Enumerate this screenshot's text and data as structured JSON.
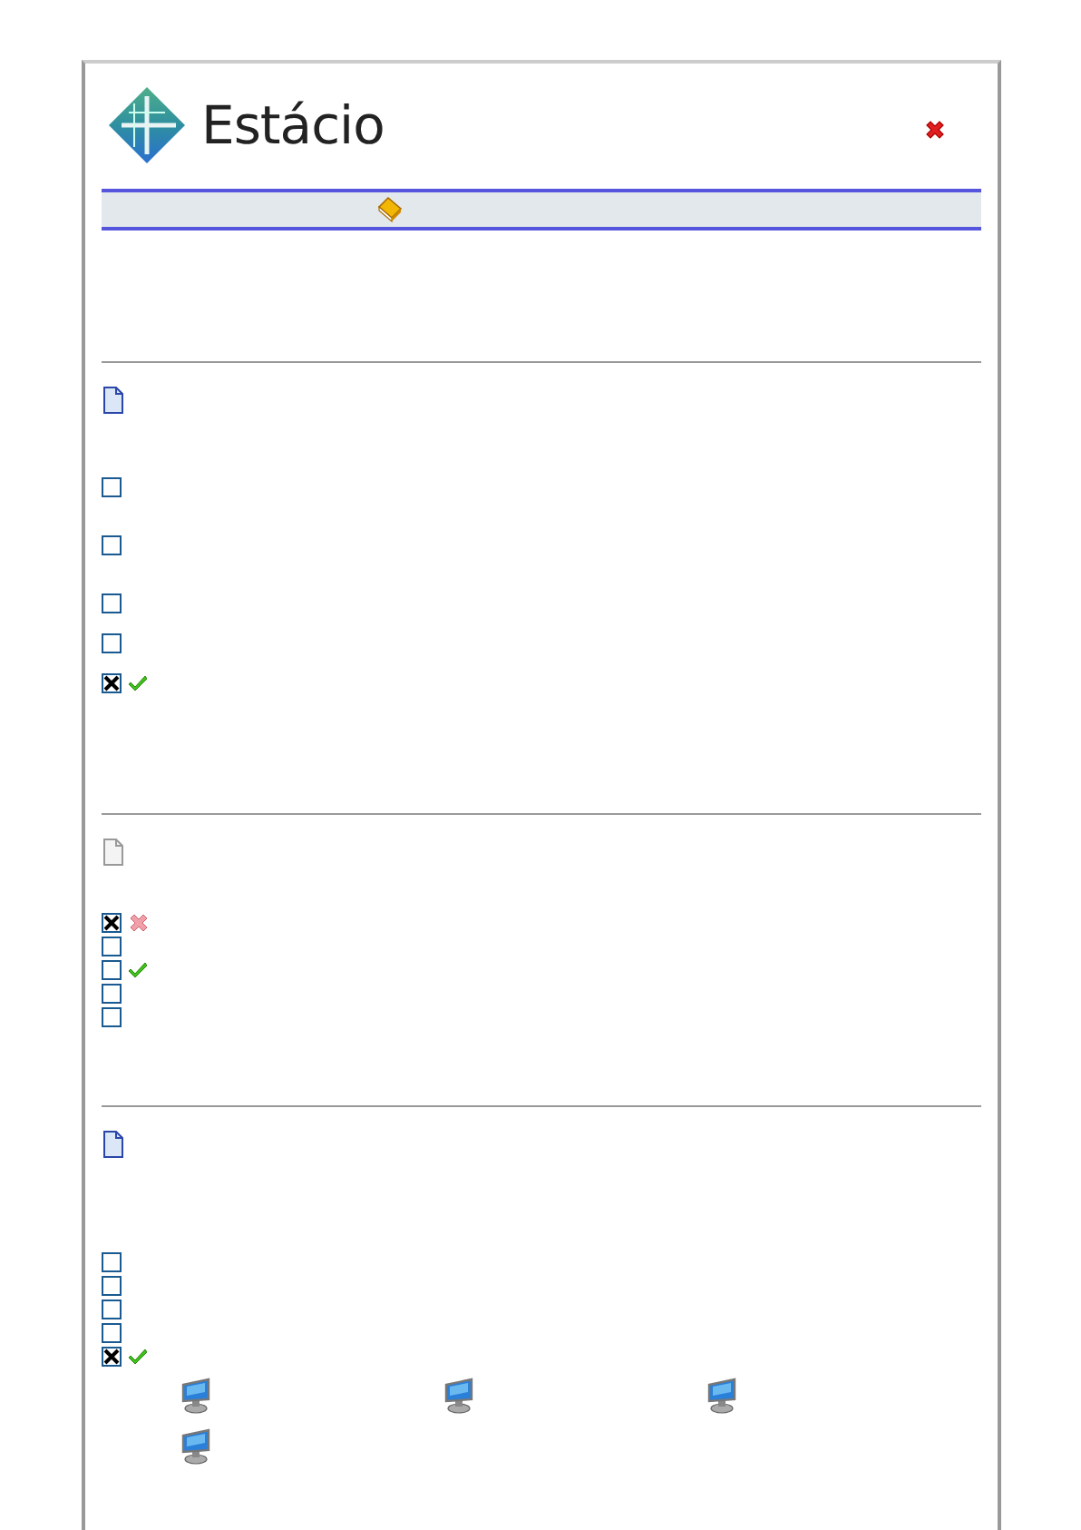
{
  "header": {
    "logo_text": "Estácio"
  },
  "questions": [
    {
      "active": true,
      "options": [
        {
          "checked": false,
          "marked_correct": false,
          "marked_wrong": false
        },
        {
          "checked": false,
          "marked_correct": false,
          "marked_wrong": false
        },
        {
          "checked": false,
          "marked_correct": false,
          "marked_wrong": false
        },
        {
          "checked": false,
          "marked_correct": false,
          "marked_wrong": false
        },
        {
          "checked": true,
          "marked_correct": true,
          "marked_wrong": false
        }
      ]
    },
    {
      "active": false,
      "options": [
        {
          "checked": true,
          "marked_correct": false,
          "marked_wrong": true
        },
        {
          "checked": false,
          "marked_correct": false,
          "marked_wrong": false
        },
        {
          "checked": false,
          "marked_correct": true,
          "marked_wrong": false
        },
        {
          "checked": false,
          "marked_correct": false,
          "marked_wrong": false
        },
        {
          "checked": false,
          "marked_correct": false,
          "marked_wrong": false
        }
      ]
    },
    {
      "active": true,
      "options": [
        {
          "checked": false,
          "marked_correct": false,
          "marked_wrong": false
        },
        {
          "checked": false,
          "marked_correct": false,
          "marked_wrong": false
        },
        {
          "checked": false,
          "marked_correct": false,
          "marked_wrong": false
        },
        {
          "checked": false,
          "marked_correct": false,
          "marked_wrong": false
        },
        {
          "checked": true,
          "marked_correct": true,
          "marked_wrong": false
        }
      ]
    }
  ],
  "workstations": [
    {
      "kind": "monitor"
    },
    {
      "kind": "monitor"
    },
    {
      "kind": "monitor"
    },
    {
      "kind": "monitor"
    }
  ]
}
